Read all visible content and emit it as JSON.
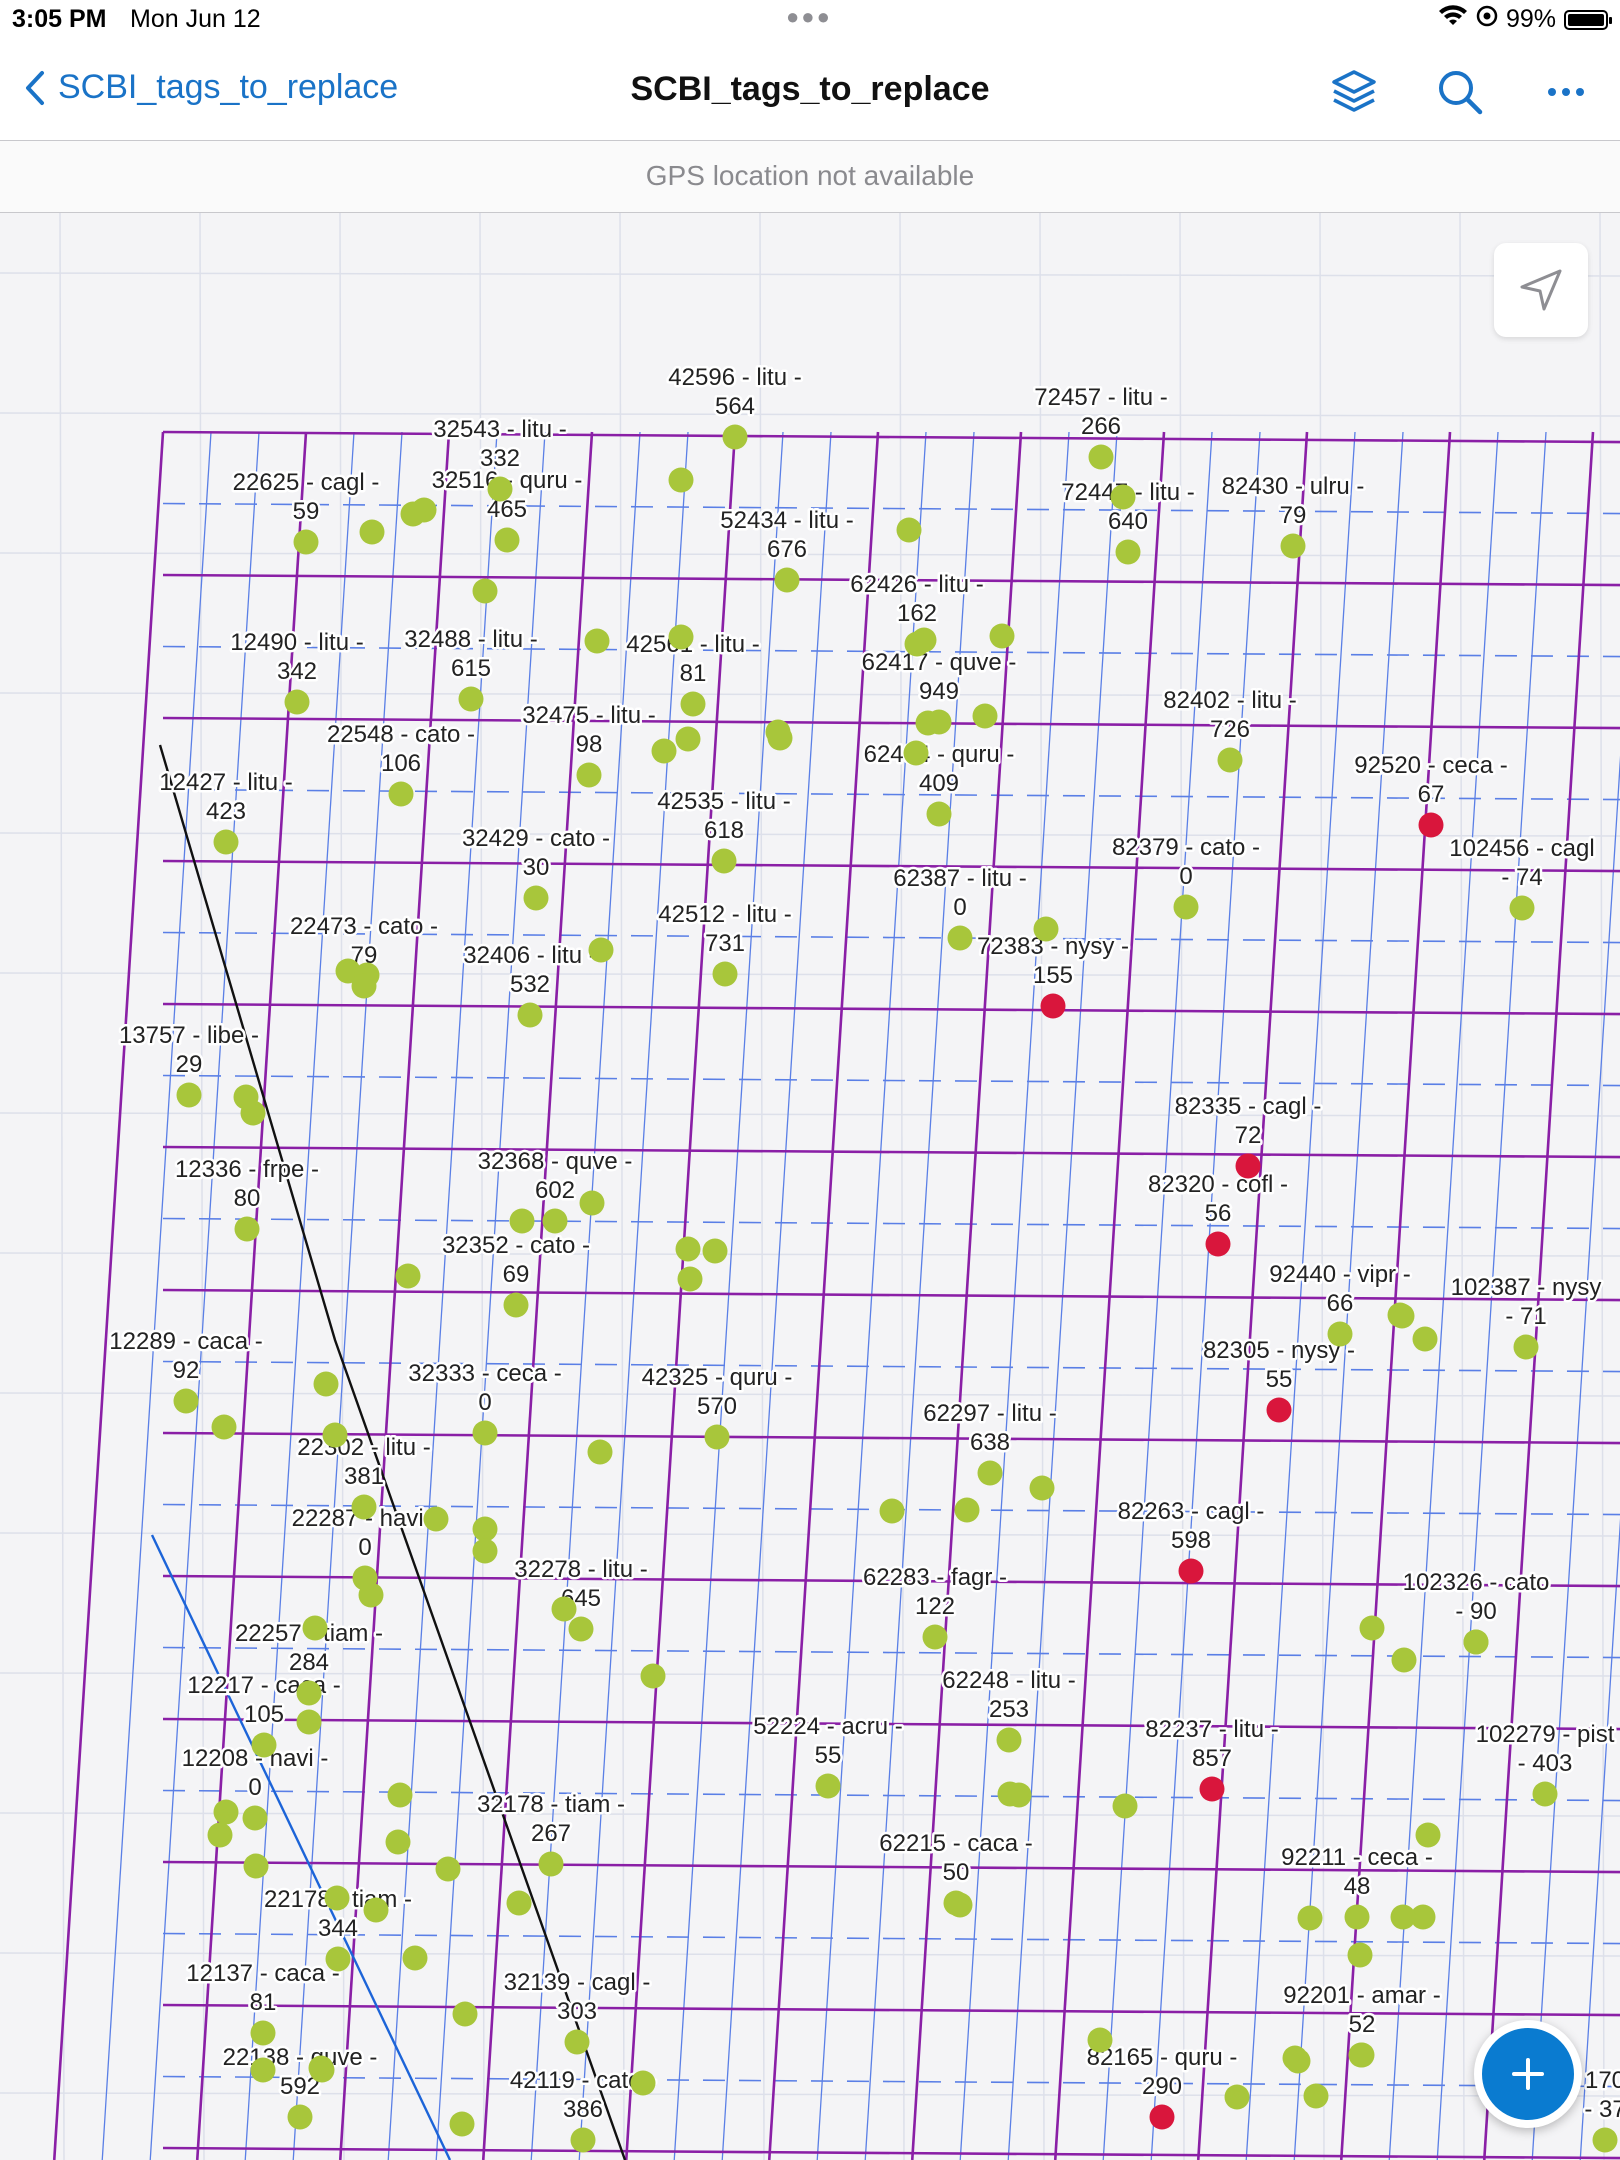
{
  "status_bar": {
    "time": "3:05 PM",
    "date": "Mon Jun 12",
    "battery": "99%",
    "battery_level": 0.99
  },
  "nav": {
    "back_label": "SCBI_tags_to_replace",
    "title": "SCBI_tags_to_replace",
    "icons": [
      "layers-icon",
      "search-icon",
      "more-icon"
    ]
  },
  "gps_banner": "GPS location not available",
  "map": {
    "colors": {
      "healthy": "#a8c63b",
      "flagged": "#d9163c",
      "grid_major": "#8a1fa6",
      "grid_minor": "#5a7fe6"
    },
    "tags": [
      {
        "label": "42596 - litu -\n564",
        "status": "healthy"
      },
      {
        "label": "72457 - litu -\n266",
        "status": "healthy"
      },
      {
        "label": "32543 - litu -\n332",
        "status": "healthy"
      },
      {
        "label": "22625 - cagl -\n59",
        "status": "healthy"
      },
      {
        "label": "32516 - quru -\n465",
        "status": "healthy"
      },
      {
        "label": "52434 - litu -\n676",
        "status": "healthy"
      },
      {
        "label": "72447 - litu -\n640",
        "status": "healthy"
      },
      {
        "label": "82430 - ulru -\n79",
        "status": "healthy"
      },
      {
        "label": "62426 - litu -\n162",
        "status": "healthy"
      },
      {
        "label": "12490 - litu -\n342",
        "status": "healthy"
      },
      {
        "label": "32488 - litu -\n615",
        "status": "healthy"
      },
      {
        "label": "42561 - litu -\n81",
        "status": "healthy"
      },
      {
        "label": "62417 - quve -\n949",
        "status": "healthy"
      },
      {
        "label": "82402 - litu -\n726",
        "status": "healthy"
      },
      {
        "label": "22548 - cato -\n106",
        "status": "healthy"
      },
      {
        "label": "32475 - litu -\n98",
        "status": "healthy"
      },
      {
        "label": "62404 - quru -\n409",
        "status": "healthy"
      },
      {
        "label": "92520 - ceca -\n67",
        "status": "flagged"
      },
      {
        "label": "12427 - litu -\n423",
        "status": "healthy"
      },
      {
        "label": "42535 - litu -\n618",
        "status": "healthy"
      },
      {
        "label": "102456 - cagl\n- 74",
        "status": "healthy"
      },
      {
        "label": "32429 - cato -\n30",
        "status": "healthy"
      },
      {
        "label": "82379 - cato -\n0",
        "status": "healthy"
      },
      {
        "label": "62387 - litu -\n0",
        "status": "healthy"
      },
      {
        "label": "22473 - cato -\n79",
        "status": "healthy"
      },
      {
        "label": "42512 - litu -\n731",
        "status": "healthy"
      },
      {
        "label": "32406 - litu -\n532",
        "status": "healthy"
      },
      {
        "label": "72383 - nysy -\n155",
        "status": "flagged"
      },
      {
        "label": "13757 - libe -\n29",
        "status": "healthy"
      },
      {
        "label": "82335 - cagl -\n72",
        "status": "flagged"
      },
      {
        "label": "12336 - frpe -\n80",
        "status": "healthy"
      },
      {
        "label": "32368 - quve -\n602",
        "status": "healthy"
      },
      {
        "label": "82320 - cofl -\n56",
        "status": "flagged"
      },
      {
        "label": "32352 - cato -\n69",
        "status": "healthy"
      },
      {
        "label": "92440 - vipr -\n66",
        "status": "healthy"
      },
      {
        "label": "102387 - nysy\n- 71",
        "status": "healthy"
      },
      {
        "label": "82305 - nysy -\n55",
        "status": "flagged"
      },
      {
        "label": "12289 - caca -\n92",
        "status": "healthy"
      },
      {
        "label": "32333 - ceca -\n0",
        "status": "healthy"
      },
      {
        "label": "42325 - quru -\n570",
        "status": "healthy"
      },
      {
        "label": "62297 - litu -\n638",
        "status": "healthy"
      },
      {
        "label": "22302 - litu -\n381",
        "status": "healthy"
      },
      {
        "label": "82263 - cagl -\n598",
        "status": "flagged"
      },
      {
        "label": "22287 - havi -\n0",
        "status": "healthy"
      },
      {
        "label": "32278 - litu -\n645",
        "status": "healthy"
      },
      {
        "label": "62283 - fagr -\n122",
        "status": "healthy"
      },
      {
        "label": "102326 - cato\n- 90",
        "status": "healthy"
      },
      {
        "label": "22257 - tiam -\n284",
        "status": "healthy"
      },
      {
        "label": "62248 - litu -\n253",
        "status": "healthy"
      },
      {
        "label": "12217 - caca -\n105",
        "status": "healthy"
      },
      {
        "label": "52224 - acru -\n55",
        "status": "healthy"
      },
      {
        "label": "82237 - litu -\n857",
        "status": "flagged"
      },
      {
        "label": "102279 - pist\n- 403",
        "status": "healthy"
      },
      {
        "label": "12208 - havi -\n0",
        "status": "healthy"
      },
      {
        "label": "32178 - tiam -\n267",
        "status": "healthy"
      },
      {
        "label": "62215 - caca -\n50",
        "status": "healthy"
      },
      {
        "label": "92211 - ceca -\n48",
        "status": "healthy"
      },
      {
        "label": "22178 - tiam -\n344",
        "status": "healthy"
      },
      {
        "label": "12137 - caca -\n81",
        "status": "healthy"
      },
      {
        "label": "32139 - cagl -\n303",
        "status": "healthy"
      },
      {
        "label": "92201 - amar -\n52",
        "status": "healthy"
      },
      {
        "label": "82165 - quru -\n290",
        "status": "flagged"
      },
      {
        "label": "22138 - quve -\n592",
        "status": "healthy"
      },
      {
        "label": "42119 - cato -\n386",
        "status": "healthy"
      },
      {
        "label": "170\n- 37",
        "status": "healthy"
      }
    ]
  }
}
